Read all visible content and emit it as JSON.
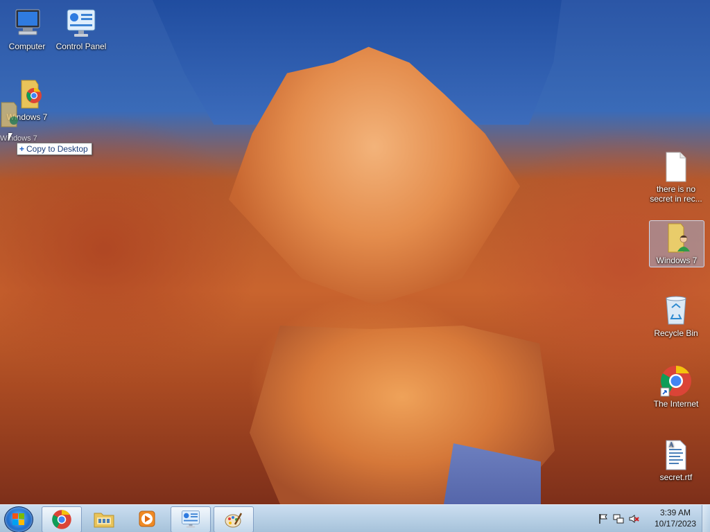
{
  "desktop": {
    "icons_left": [
      {
        "id": "computer",
        "label": "Computer",
        "icon": "computer-icon"
      },
      {
        "id": "control-panel",
        "label": "Control Panel",
        "icon": "control-panel-icon"
      },
      {
        "id": "windows7-folder-left",
        "label": "Windows 7",
        "icon": "chrome-folder-icon"
      }
    ],
    "icons_right": [
      {
        "id": "secret-txt",
        "label": "there is no secret in rec...",
        "icon": "text-file-icon"
      },
      {
        "id": "windows7-folder-right",
        "label": "Windows 7",
        "icon": "user-folder-icon",
        "selected": true
      },
      {
        "id": "recycle-bin",
        "label": "Recycle Bin",
        "icon": "recycle-bin-icon"
      },
      {
        "id": "the-internet",
        "label": "The Internet",
        "icon": "chrome-shortcut-icon"
      },
      {
        "id": "secret-rtf",
        "label": "secret.rtf",
        "icon": "rtf-file-icon"
      }
    ],
    "drag": {
      "ghost_label": "Windows 7",
      "tooltip": "Copy to Desktop"
    }
  },
  "taskbar": {
    "buttons": [
      {
        "id": "start",
        "icon": "windows-start-icon"
      },
      {
        "id": "chrome",
        "icon": "chrome-icon"
      },
      {
        "id": "explorer",
        "icon": "file-explorer-icon"
      },
      {
        "id": "media-player",
        "icon": "media-player-icon"
      },
      {
        "id": "control-panel",
        "icon": "control-panel-icon"
      },
      {
        "id": "paint",
        "icon": "paint-icon"
      }
    ],
    "tray": {
      "icons": [
        "action-center-flag-icon",
        "network-icon",
        "volume-muted-icon"
      ]
    },
    "clock": {
      "time": "3:39 AM",
      "date": "10/17/2023"
    }
  },
  "colors": {
    "sky": "#2b56a6",
    "rock": "#c9642e",
    "taskbar": "#b8cfe6",
    "selection": "#9ebef0"
  }
}
